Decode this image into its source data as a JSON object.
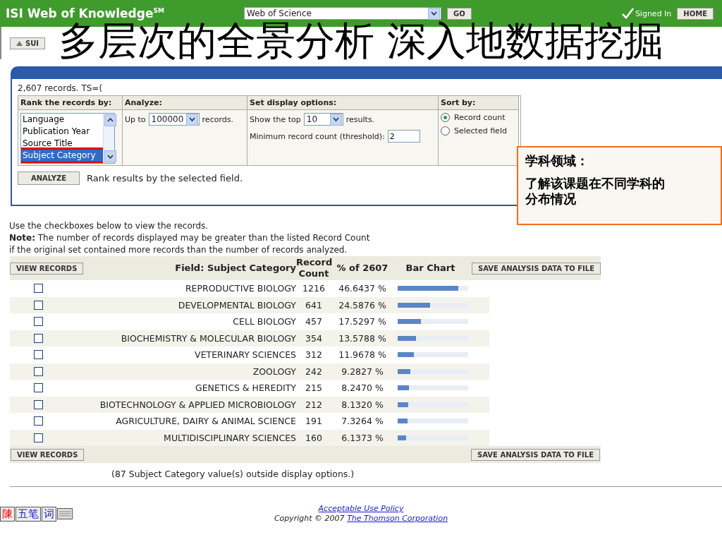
{
  "slide_title": "多层次的全景分析 深入地数据挖掘",
  "header": {
    "logo": "ISI Web of Knowledge",
    "logo_mark": "SM",
    "database": "Web of Science",
    "go": "GO",
    "signed_in": "Signed In",
    "home": "HOME"
  },
  "toolbar": {
    "button": "SUI"
  },
  "analysis_panel": {
    "records_line": "2,607 records. TS=(",
    "columns": [
      "Rank the records by:",
      "Analyze:",
      "Set display options:",
      "Sort by:"
    ],
    "rank_list": [
      {
        "label": "Language",
        "selected": false
      },
      {
        "label": "Publication Year",
        "selected": false
      },
      {
        "label": "Source Title",
        "selected": false
      },
      {
        "label": "Subject Category",
        "selected": true
      }
    ],
    "analyze_prefix": "Up to",
    "analyze_value": "100000",
    "analyze_suffix": "records.",
    "show_top_prefix": "Show the top",
    "show_top_value": "10",
    "show_top_suffix": "results.",
    "threshold_label": "Minimum record count (threshold):",
    "threshold_value": "2",
    "sort_options": [
      {
        "label": "Record count",
        "selected": true
      },
      {
        "label": "Selected field",
        "selected": false
      }
    ],
    "analyze_button": "ANALYZE",
    "analyze_hint": "Rank results by the selected field."
  },
  "callout": {
    "heading": "学科领域：",
    "body": "了解该课题在不同学科的分布情况"
  },
  "instructions": "Use the checkboxes below to view the records.",
  "note": "**Note:** The number of records displayed may be greater than the listed Record Count",
  "note_2": "if the original set contained more records than the number of records analyzed.",
  "results": {
    "view_records": "VIEW RECORDS",
    "save": "SAVE ANALYSIS DATA TO FILE",
    "columns": [
      "Field: Subject Category",
      "Record Count",
      "% of 2607",
      "Bar Chart"
    ],
    "rows": [
      {
        "checked": false,
        "field": "REPRODUCTIVE BIOLOGY",
        "count": "1216",
        "percent": "46.6437 %",
        "level": 0.86
      },
      {
        "checked": false,
        "field": "DEVELOPMENTAL BIOLOGY",
        "count": "641",
        "percent": "24.5876 %",
        "level": 0.46
      },
      {
        "checked": false,
        "field": "CELL BIOLOGY",
        "count": "457",
        "percent": "17.5297 %",
        "level": 0.33
      },
      {
        "checked": false,
        "field": "BIOCHEMISTRY & MOLECULAR BIOLOGY",
        "count": "354",
        "percent": "13.5788 %",
        "level": 0.26
      },
      {
        "checked": false,
        "field": "VETERINARY SCIENCES",
        "count": "312",
        "percent": "11.9678 %",
        "level": 0.23
      },
      {
        "checked": false,
        "field": "ZOOLOGY",
        "count": "242",
        "percent": "9.2827 %",
        "level": 0.18
      },
      {
        "checked": false,
        "field": "GENETICS & HEREDITY",
        "count": "215",
        "percent": "8.2470 %",
        "level": 0.16
      },
      {
        "checked": false,
        "field": "BIOTECHNOLOGY & APPLIED MICROBIOLOGY",
        "count": "212",
        "percent": "8.1320 %",
        "level": 0.15
      },
      {
        "checked": false,
        "field": "AGRICULTURE, DAIRY & ANIMAL SCIENCE",
        "count": "191",
        "percent": "7.3264 %",
        "level": 0.14
      },
      {
        "checked": false,
        "field": "MULTIDISCIPLINARY SCIENCES",
        "count": "160",
        "percent": "6.1373 %",
        "level": 0.12
      }
    ],
    "view_records_bottom": "VIEW RECORDS",
    "save_bottom": "SAVE ANALYSIS DATA TO FILE",
    "outside_note": "(87 Subject Category value(s) outside display options.)"
  },
  "ime_bar": {
    "items": [
      "陳",
      "五笔",
      "词"
    ]
  },
  "footer": {
    "policy_link": "Acceptable Use Policy",
    "copyright": "Copyright © 2007",
    "company_link": "The Thomson Corporation"
  }
}
